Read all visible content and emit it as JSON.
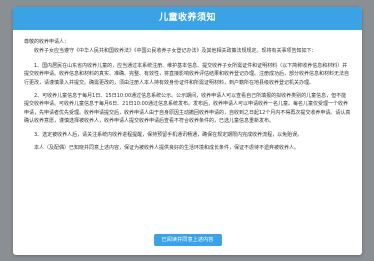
{
  "modal": {
    "title": "儿童收养须知",
    "greeting": "尊敬的收养申请人：",
    "intro": "收养子女应当遵守《中华人民共和国收养法》《中国公民收养子女登记办法》及其他相关政策法规规定。现将有关事项告知如下：",
    "paragraphs": [
      "1、国内居民在山东省内收养儿童的，应当通过本系统注册、维护基本信息、提交收养子女所需证件和证明材料（以下简称收养信息和材料）并提交收养申请。收养信息和材料的真实、准确、完整、有效性，将直接影响收养评估结果和收养登记办理。注册成功后，部分收养信息和材料无法自行更改，请谨慎录入并提交。确需更改的，须由注册人本人持有效身份证件和所需证明材料，到户籍所在地县级收养登记机关办理。",
      "2、可收养儿童信息于每月1日、15日10:00通过信息系统公示。公示期间，收养申请人可以查看自己所填报的拟收养类别的儿童信息，但不能提交收养申请。可收养儿童信息于每月6日、21日10:00通过信息系统发布。发布后，收养申请人可以申请收养一名儿童。每名儿童仅受理一个收养申请，先申请者优先受理。收养申请提交后，收养申请人由于自身原因主动撤回收养申请的，自收到之日起12个月内不得再次提交收养申请。请认真确认收养意愿，谨慎选择被收养人，收养申请人提交收养申请后查看不符合收养条件的，已选儿童信息重新发布。",
      "3、选定被收养人后，请关注系统内收养进程提醒，保持预留手机通讯畅通，确保在规定期限内完成收养流程，以免贻误。",
      "本人（及配偶）已知晓并同意上述内容，保证为被收养人提供良好的生活环境和成长条件，保证不虐待不遗弃被收养人。"
    ],
    "confirm_label": "已阅读并同意上述内容"
  },
  "colors": {
    "accent": "#39a3e6",
    "overlay": "#8a8f94"
  }
}
